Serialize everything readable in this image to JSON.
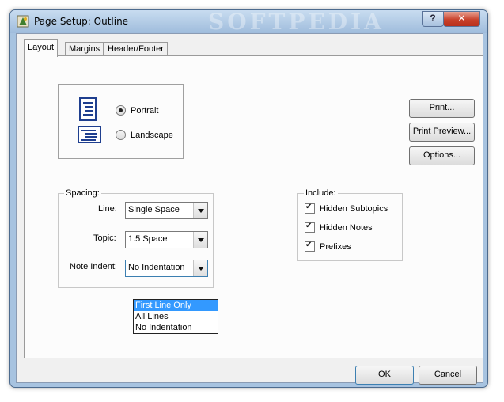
{
  "window": {
    "title": "Page Setup: Outline",
    "watermark": "SOFTPEDIA",
    "help_label": "?",
    "close_label": "✕"
  },
  "tabs": [
    {
      "label": "Layout",
      "active": true
    },
    {
      "label": "Margins",
      "active": false
    },
    {
      "label": "Header/Footer",
      "active": false
    }
  ],
  "orientation": {
    "portrait_label": "Portrait",
    "landscape_label": "Landscape",
    "selected": "portrait"
  },
  "side_buttons": {
    "print": "Print...",
    "print_preview": "Print Preview...",
    "options": "Options..."
  },
  "spacing": {
    "title": "Spacing:",
    "line_label": "Line:",
    "line_value": "Single Space",
    "topic_label": "Topic:",
    "topic_value": "1.5 Space",
    "note_indent_label": "Note Indent:",
    "note_indent_value": "No Indentation",
    "note_indent_options": [
      "First Line Only",
      "All Lines",
      "No Indentation"
    ],
    "note_indent_highlighted": "First Line Only"
  },
  "include": {
    "title": "Include:",
    "items": [
      {
        "label": "Hidden Subtopics",
        "checked": true
      },
      {
        "label": "Hidden Notes",
        "checked": true
      },
      {
        "label": "Prefixes",
        "checked": true
      }
    ]
  },
  "footer": {
    "ok": "OK",
    "cancel": "Cancel"
  },
  "colors": {
    "highlight": "#3399ff",
    "title_bar": "#a7c3e0",
    "close_button": "#c8412b",
    "icon_blue": "#1f3f8f"
  }
}
